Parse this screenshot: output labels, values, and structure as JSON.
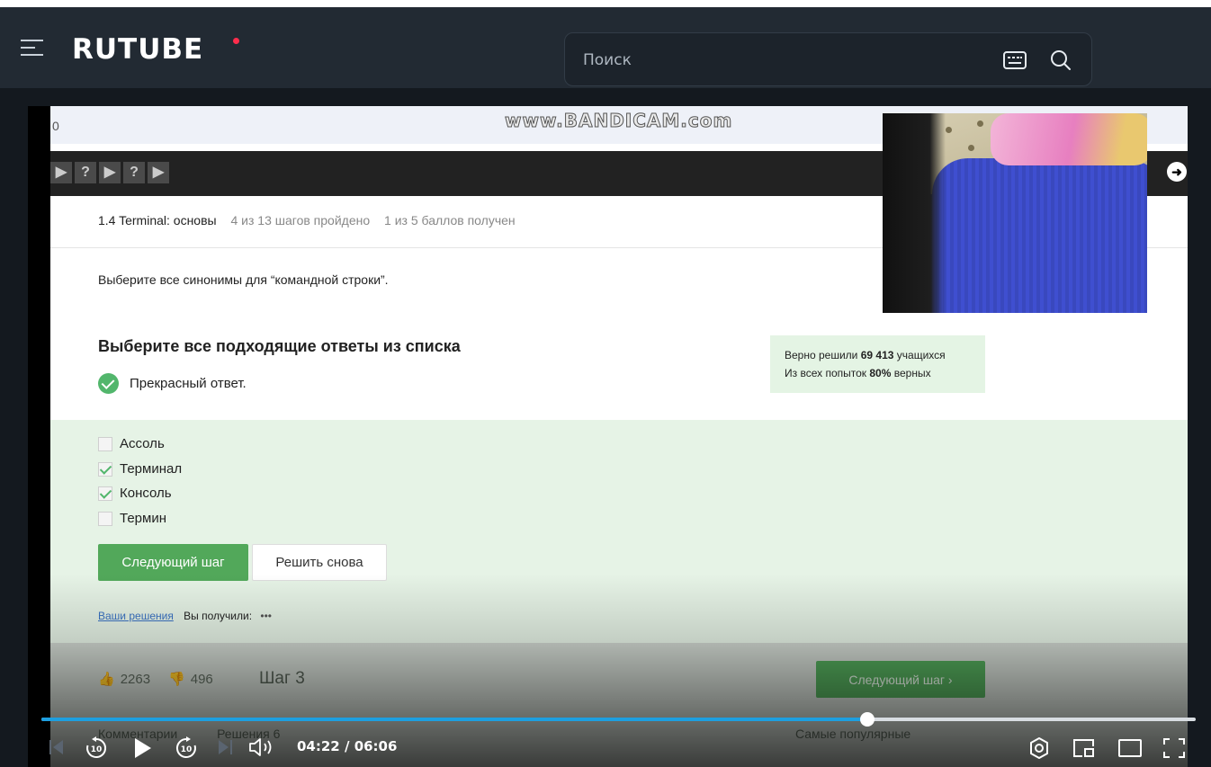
{
  "app": {
    "logo": "RUTUBE",
    "search_placeholder": "Поиск"
  },
  "video": {
    "watermark": "www.BANDICAM.com",
    "url_fragment": "0",
    "course": {
      "lesson_title": "1.4 Terminal: основы",
      "steps_progress": "4 из 13 шагов пройдено",
      "score_progress": "1 из 5 баллов  получен",
      "question": "Выберите все синонимы для “командной строки”.",
      "subtitle": "Выберите все подходящие ответы из списка",
      "verdict": "Прекрасный ответ.",
      "stats": {
        "solved_prefix": "Верно решили",
        "solved_count": "69 413",
        "solved_suffix": "учащихся",
        "attempts_prefix": "Из всех попыток",
        "attempts_percent": "80%",
        "attempts_suffix": "верных"
      },
      "options": [
        {
          "label": "Ассоль",
          "checked": false
        },
        {
          "label": "Терминал",
          "checked": true
        },
        {
          "label": "Консоль",
          "checked": true
        },
        {
          "label": "Термин",
          "checked": false
        }
      ],
      "next_button": "Следующий шаг",
      "retry_button": "Решить снова",
      "your_solutions_link": "Ваши решения",
      "you_got": "Вы получили:",
      "likes": "2263",
      "dislikes": "496",
      "step_label": "Шаг 3",
      "next_small": "Следующий шаг",
      "comments": "Комментарии",
      "solutions": "Решения",
      "solutions_count": "6",
      "sort": "Самые популярные"
    }
  },
  "player": {
    "current_time": "04:22",
    "duration": "06:06",
    "progress": 0.7158,
    "accent_color": "#1d9fe0"
  }
}
